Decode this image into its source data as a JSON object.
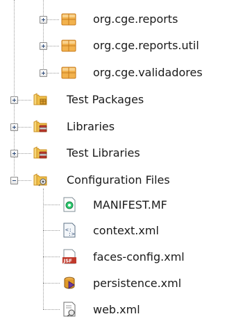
{
  "colors": {
    "package": "#e8a33a",
    "folder": "#f0c04a",
    "dotted_line": "#9a9a9a",
    "text": "#1a1a1a"
  },
  "tree": {
    "packages": [
      {
        "label": "org.cge.reports",
        "icon": "package-icon",
        "expanded": false
      },
      {
        "label": "org.cge.reports.util",
        "icon": "package-icon",
        "expanded": false
      },
      {
        "label": "org.cge.validadores",
        "icon": "package-icon",
        "expanded": false
      }
    ],
    "nodes": [
      {
        "label": "Test Packages",
        "icon": "test-packages-folder-icon",
        "expanded": false
      },
      {
        "label": "Libraries",
        "icon": "libraries-folder-icon",
        "expanded": false
      },
      {
        "label": "Test Libraries",
        "icon": "test-libraries-folder-icon",
        "expanded": false
      },
      {
        "label": "Configuration Files",
        "icon": "configuration-files-folder-icon",
        "expanded": true
      }
    ],
    "config_files": [
      {
        "label": "MANIFEST.MF",
        "icon": "manifest-file-icon"
      },
      {
        "label": "context.xml",
        "icon": "xml-file-icon"
      },
      {
        "label": "faces-config.xml",
        "icon": "jsf-file-icon"
      },
      {
        "label": "persistence.xml",
        "icon": "persistence-file-icon"
      },
      {
        "label": "web.xml",
        "icon": "web-xml-file-icon"
      }
    ]
  }
}
